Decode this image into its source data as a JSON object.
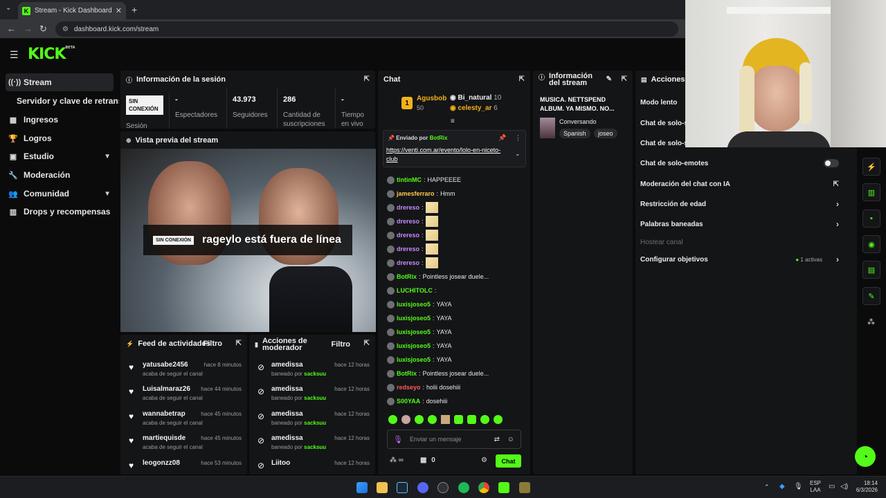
{
  "browser": {
    "tab_title": "Stream - Kick Dashboard",
    "tab_favicon": "K",
    "url": "dashboard.kick.com/stream"
  },
  "brand": {
    "logo": "KICK",
    "logo_sup": "BETA",
    "accent": "#53fc18"
  },
  "sidebar": {
    "items": [
      {
        "label": "Stream",
        "icon": "broadcast-icon"
      },
      {
        "label": "Servidor y clave de retransmisión",
        "icon": ""
      },
      {
        "label": "Ingresos",
        "icon": "money-icon"
      },
      {
        "label": "Logros",
        "icon": "trophy-icon"
      },
      {
        "label": "Estudio",
        "icon": "studio-icon"
      },
      {
        "label": "Moderación",
        "icon": "wrench-icon"
      },
      {
        "label": "Comunidad",
        "icon": "people-icon"
      },
      {
        "label": "Drops y recompensas",
        "icon": "gift-icon"
      }
    ]
  },
  "session": {
    "title": "Información de la sesión",
    "status_badge": "SIN CONEXIÓN",
    "status_label": "Sesión",
    "stats": [
      {
        "value": "-",
        "label": "Espectadores"
      },
      {
        "value": "43.973",
        "label": "Seguidores"
      },
      {
        "value": "286",
        "label": "Cantidad de suscripciones"
      },
      {
        "value": "-",
        "label": "Tiempo en vivo"
      }
    ]
  },
  "preview": {
    "title": "Vista previa del stream",
    "offline_badge": "SIN CONEXIÓN",
    "offline_text": "rageylo está fuera de línea"
  },
  "activity_feed": {
    "title": "Feed de actividades",
    "filter": "Filtro",
    "items": [
      {
        "name": "yatusabe2456",
        "time": "hace 8 minutos",
        "desc": "acaba de seguir el canal"
      },
      {
        "name": "Luisalmaraz26",
        "time": "hace 44 minutos",
        "desc": "acaba de seguir el canal"
      },
      {
        "name": "wannabetrap",
        "time": "hace 45 minutos",
        "desc": "acaba de seguir el canal"
      },
      {
        "name": "martiequisde",
        "time": "hace 45 minutos",
        "desc": "acaba de seguir el canal"
      },
      {
        "name": "leogonzz08",
        "time": "hace 53 minutos",
        "desc": ""
      }
    ]
  },
  "mod_actions": {
    "title": "Acciones de moderador",
    "filter": "Filtro",
    "banned_by": "baneado por",
    "items": [
      {
        "name": "amedissa",
        "time": "hace 12 horas",
        "by": "sacksuu"
      },
      {
        "name": "amedissa",
        "time": "hace 12 horas",
        "by": "sacksuu"
      },
      {
        "name": "amedissa",
        "time": "hace 12 horas",
        "by": "sacksuu"
      },
      {
        "name": "amedissa",
        "time": "hace 12 horas",
        "by": "sacksuu"
      },
      {
        "name": "Liitoo",
        "time": "hace 12 horas",
        "by": ""
      }
    ]
  },
  "chat": {
    "title": "Chat",
    "leaderboard": [
      {
        "rank": "1",
        "name": "Agusbob",
        "count": "50"
      },
      {
        "name": "Bi_natural",
        "count": "10"
      },
      {
        "name": "celesty_ar",
        "count": "6"
      }
    ],
    "pinned_by_label": "Enviado por",
    "pinned_by": "BotRix",
    "pinned_link": "https://venti.com.ar/evento/lolo-en-niceto-club",
    "messages": [
      {
        "user": "tintinMC",
        "text": "HAPPEEEE",
        "color": "#53fc18"
      },
      {
        "user": "jamesferraro",
        "text": "Hmm",
        "color": "#ffc94a"
      },
      {
        "user": "drereso",
        "text": "",
        "color": "#c38cff",
        "emote": true
      },
      {
        "user": "drereso",
        "text": "",
        "color": "#c38cff",
        "emote": true
      },
      {
        "user": "drereso",
        "text": "",
        "color": "#c38cff",
        "emote": true
      },
      {
        "user": "drereso",
        "text": "",
        "color": "#c38cff",
        "emote": true
      },
      {
        "user": "drereso",
        "text": "",
        "color": "#c38cff",
        "emote": true
      },
      {
        "user": "BotRix",
        "text": "Pointless josear duele...",
        "color": "#53fc18"
      },
      {
        "user": "LUCHITOLC",
        "text": "",
        "color": "#53fc18"
      },
      {
        "user": "luxisjoseo5",
        "text": "YAYA",
        "color": "#53fc18"
      },
      {
        "user": "luxisjoseo5",
        "text": "YAYA",
        "color": "#53fc18"
      },
      {
        "user": "luxisjoseo5",
        "text": "YAYA",
        "color": "#53fc18"
      },
      {
        "user": "luxisjoseo5",
        "text": "YAYA",
        "color": "#53fc18"
      },
      {
        "user": "luxisjoseo5",
        "text": "YAYA",
        "color": "#53fc18"
      },
      {
        "user": "BotRix",
        "text": "Pointless josear duele...",
        "color": "#53fc18"
      },
      {
        "user": "redseyo",
        "text": "holii dosehiii",
        "color": "#ff5a5a"
      },
      {
        "user": "S00YAA",
        "text": "dosehiii",
        "color": "#53fc18"
      }
    ],
    "input_placeholder": "Enviar un mensaje",
    "points": "0",
    "send_label": "Chat"
  },
  "stream_info": {
    "title": "Información del stream",
    "stream_title": "MUSICA. NETTSPEND ALBUM. YA MISMO. NO...",
    "category": "Conversando",
    "tags": [
      "Spanish",
      "joseo"
    ]
  },
  "actions": {
    "title": "Acciones de",
    "items": [
      {
        "label": "Modo lento",
        "type": "none"
      },
      {
        "label": "Chat de solo-s",
        "type": "none"
      },
      {
        "label": "Chat de solo-s",
        "type": "none"
      },
      {
        "label": "Chat de solo-emotes",
        "type": "toggle"
      },
      {
        "label": "Moderación del chat con IA",
        "type": "external"
      },
      {
        "label": "Restricción de edad",
        "type": "chevron"
      },
      {
        "label": "Palabras baneadas",
        "type": "chevron"
      },
      {
        "label": "Hostear canal",
        "type": "disabled"
      },
      {
        "label": "Configurar objetivos",
        "type": "chevron",
        "extra": "1 activas"
      }
    ]
  },
  "taskbar": {
    "lang": "ESP",
    "lang2": "LAA",
    "time": "18:14",
    "date": "6/3/2026"
  }
}
